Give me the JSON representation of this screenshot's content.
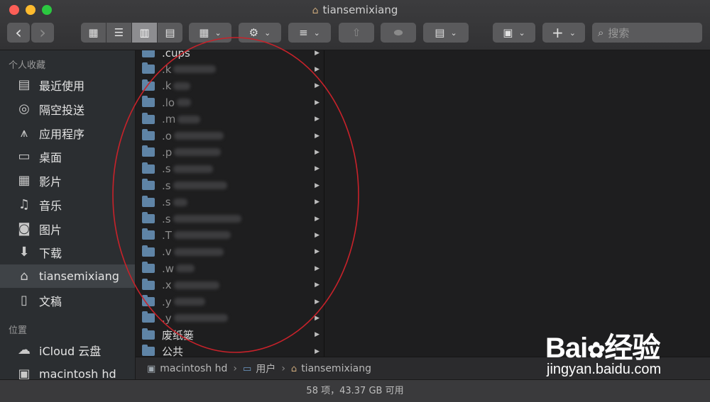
{
  "window": {
    "title": "tiansemixiang",
    "home_glyph": "⌂"
  },
  "toolbar": {
    "back": "‹",
    "forward": "›",
    "views": [
      "▦",
      "☰",
      "▥",
      "▤"
    ],
    "group_glyph": "▦",
    "action_glyph": "⚙",
    "arrange_glyph": "≡",
    "share_glyph": "⇧",
    "tag_glyph": "⬬",
    "newfile_glyph": "▤",
    "disk_glyph": "▣",
    "add_glyph": "+",
    "caret": "⌄",
    "search_placeholder": "搜索",
    "search_glyph": "⌕"
  },
  "sidebar": {
    "favorites_header": "个人收藏",
    "locations_header": "位置",
    "favorites": [
      {
        "label": "最近使用",
        "icon": "▤"
      },
      {
        "label": "隔空投送",
        "icon": "◎"
      },
      {
        "label": "应用程序",
        "icon": "⩚"
      },
      {
        "label": "桌面",
        "icon": "▭"
      },
      {
        "label": "影片",
        "icon": "▦"
      },
      {
        "label": "音乐",
        "icon": "♫"
      },
      {
        "label": "图片",
        "icon": "◙"
      },
      {
        "label": "下载",
        "icon": "⬇"
      },
      {
        "label": "tiansemixiang",
        "icon": "⌂"
      },
      {
        "label": "文稿",
        "icon": "▯"
      }
    ],
    "locations": [
      {
        "label": "iCloud 云盘",
        "icon": "☁"
      },
      {
        "label": "macintosh hd",
        "icon": "▣"
      }
    ]
  },
  "files": [
    {
      "name": ".cups",
      "blur": 0
    },
    {
      "name": ".k",
      "blur": 60
    },
    {
      "name": ".k",
      "blur": 24
    },
    {
      "name": ".lo",
      "blur": 20
    },
    {
      "name": ".m",
      "blur": 32
    },
    {
      "name": ".o",
      "blur": 70
    },
    {
      "name": ".p",
      "blur": 66
    },
    {
      "name": ".s",
      "blur": 56
    },
    {
      "name": ".s",
      "blur": 76
    },
    {
      "name": ".s",
      "blur": 20
    },
    {
      "name": ".s",
      "blur": 96
    },
    {
      "name": ".T",
      "blur": 80
    },
    {
      "name": ".v",
      "blur": 70
    },
    {
      "name": ".w",
      "blur": 26
    },
    {
      "name": ".x",
      "blur": 64
    },
    {
      "name": ".y",
      "blur": 44
    },
    {
      "name": ".y",
      "blur": 76
    },
    {
      "name": "废纸篓",
      "blur": 0
    },
    {
      "name": "公共",
      "blur": 0
    }
  ],
  "pathbar": {
    "items": [
      {
        "label": "macintosh hd",
        "icon": "▣"
      },
      {
        "label": "用户",
        "icon": "▭"
      },
      {
        "label": "tiansemixiang",
        "icon": "⌂"
      }
    ],
    "separator": "›"
  },
  "status": {
    "text": "58 项，43.37 GB 可用"
  },
  "watermark": {
    "logo_left": "Bai",
    "logo_paw": "✿",
    "logo_right": "经验",
    "url": "jingyan.baidu.com"
  },
  "colors": {
    "folder": "#5f84a6",
    "annotation": "#c8222a"
  }
}
